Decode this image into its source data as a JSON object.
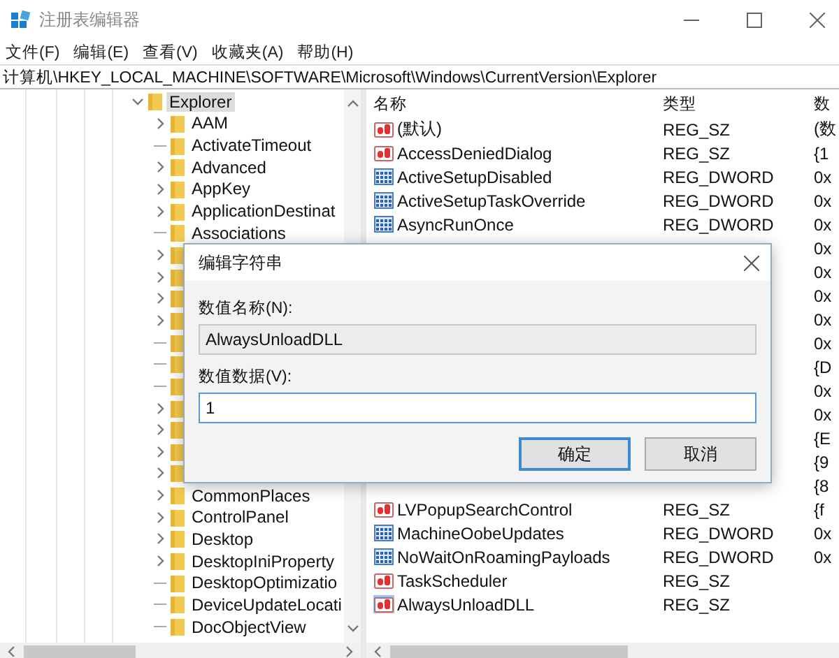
{
  "window": {
    "title": "注册表编辑器"
  },
  "menu": [
    {
      "label": "文件(F)"
    },
    {
      "label": "编辑(E)"
    },
    {
      "label": "查看(V)"
    },
    {
      "label": "收藏夹(A)"
    },
    {
      "label": "帮助(H)"
    }
  ],
  "address": "计算机\\HKEY_LOCAL_MACHINE\\SOFTWARE\\Microsoft\\Windows\\CurrentVersion\\Explorer",
  "tree": [
    {
      "name": "Explorer",
      "selected": true,
      "expanded": true,
      "children": [
        {
          "name": "AAM",
          "kind": "branch"
        },
        {
          "name": "ActivateTimeout",
          "kind": "leaf"
        },
        {
          "name": "Advanced",
          "kind": "branch"
        },
        {
          "name": "AppKey",
          "kind": "branch"
        },
        {
          "name": "ApplicationDestinat",
          "kind": "branch"
        },
        {
          "name": "Associations",
          "kind": "leaf"
        },
        {
          "kind": "branch"
        },
        {
          "kind": "branch"
        },
        {
          "kind": "branch"
        },
        {
          "kind": "branch"
        },
        {
          "kind": "leaf"
        },
        {
          "kind": "leaf"
        },
        {
          "kind": "leaf"
        },
        {
          "kind": "branch"
        },
        {
          "kind": "branch"
        },
        {
          "kind": "branch"
        },
        {
          "kind": "branch"
        },
        {
          "name": "CommonPlaces",
          "kind": "branch"
        },
        {
          "name": "ControlPanel",
          "kind": "branch"
        },
        {
          "name": "Desktop",
          "kind": "branch"
        },
        {
          "name": "DesktopIniProperty",
          "kind": "branch"
        },
        {
          "name": "DesktopOptimizatio",
          "kind": "leaf"
        },
        {
          "name": "DeviceUpdateLocati",
          "kind": "leaf"
        },
        {
          "name": "DocObjectView",
          "kind": "leaf"
        }
      ]
    }
  ],
  "values": {
    "columns": [
      "名称",
      "类型",
      "数"
    ],
    "rows": [
      {
        "name": "(默认)",
        "type": "REG_SZ",
        "data": "(数",
        "kind": "string",
        "selected": false
      },
      {
        "name": "AccessDeniedDialog",
        "type": "REG_SZ",
        "data": "{1",
        "kind": "string",
        "selected": false
      },
      {
        "name": "ActiveSetupDisabled",
        "type": "REG_DWORD",
        "data": "0x",
        "kind": "dword",
        "selected": false
      },
      {
        "name": "ActiveSetupTaskOverride",
        "type": "REG_DWORD",
        "data": "0x",
        "kind": "dword",
        "selected": false
      },
      {
        "name": "AsyncRunOnce",
        "type": "REG_DWORD",
        "data": "0x",
        "kind": "dword",
        "selected": false
      },
      {
        "data": "0x"
      },
      {
        "data": "0x"
      },
      {
        "data": "0x"
      },
      {
        "data": "0x"
      },
      {
        "data": "0x"
      },
      {
        "data": "{D"
      },
      {
        "data": "0x"
      },
      {
        "data": "0x"
      },
      {
        "data": "{E"
      },
      {
        "data": "{9"
      },
      {
        "data": "{8"
      },
      {
        "name": "LVPopupSearchControl",
        "type": "REG_SZ",
        "data": "{f",
        "kind": "string",
        "selected": false
      },
      {
        "name": "MachineOobeUpdates",
        "type": "REG_DWORD",
        "data": "0x",
        "kind": "dword",
        "selected": false
      },
      {
        "name": "NoWaitOnRoamingPayloads",
        "type": "REG_DWORD",
        "data": "0x",
        "kind": "dword",
        "selected": false
      },
      {
        "name": "TaskScheduler",
        "type": "REG_SZ",
        "kind": "string",
        "selected": false
      },
      {
        "name": "AlwaysUnloadDLL",
        "type": "REG_SZ",
        "kind": "string",
        "selected": true
      }
    ]
  },
  "dialog": {
    "title": "编辑字符串",
    "name_label": "数值名称(N):",
    "name_value": "AlwaysUnloadDLL",
    "data_label": "数值数据(V):",
    "data_value": "1",
    "buttons": [
      {
        "label": "确定",
        "default": true
      },
      {
        "label": "取消",
        "default": false
      }
    ]
  }
}
